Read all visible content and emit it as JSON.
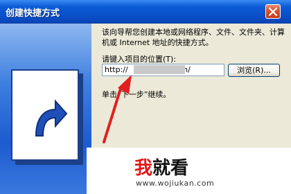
{
  "window": {
    "title": "创建快捷方式"
  },
  "content": {
    "description": "该向导帮您创建本地或网络程序、文件、文件夹、计算机或 Internet 地址的快捷方式。",
    "location_label": "请键入项目的位置(T):",
    "url_prefix": "http://",
    "url_suffix": "com/",
    "browse_label": "浏览(R)...",
    "instruction": "单击“下一步”继续。"
  },
  "watermark": {
    "logo_first": "我",
    "logo_rest": "就看",
    "url": "www.wojiukan.com"
  },
  "colors": {
    "titlebar": "#0b5bd8",
    "annotation_arrow": "#e02020",
    "watermark_red": "#e11717"
  },
  "icons": [
    "close-icon",
    "shortcut-arrow-icon",
    "red-annotation-arrow"
  ]
}
